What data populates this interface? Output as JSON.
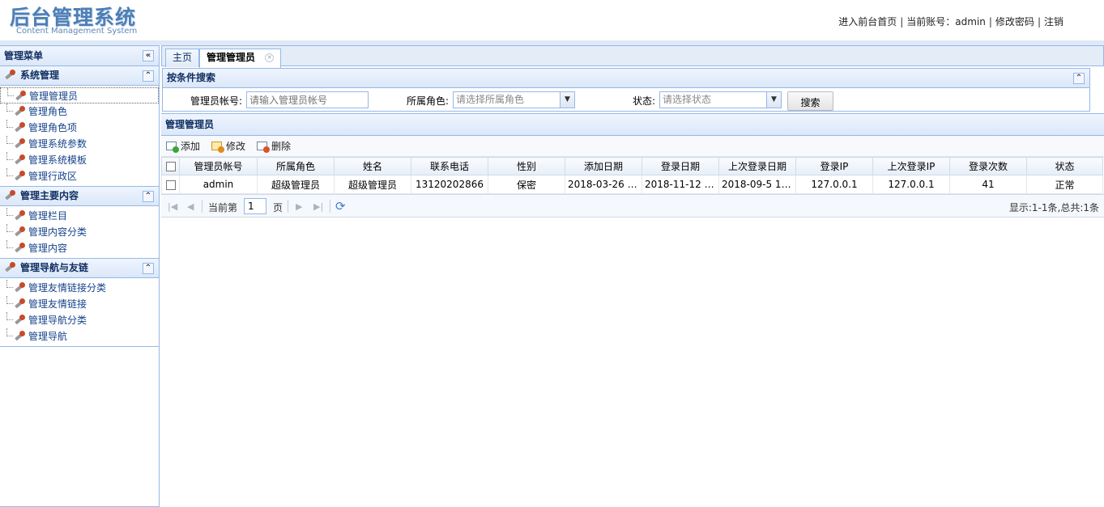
{
  "header": {
    "logo_title": "后台管理系统",
    "logo_subtitle": "Content Management System",
    "links": [
      "进入前台首页",
      "当前账号：admin",
      "修改密码",
      "注销"
    ]
  },
  "menu": {
    "title": "管理菜单",
    "groups": [
      {
        "label": "系统管理",
        "items": [
          "管理管理员",
          "管理角色",
          "管理角色项",
          "管理系统参数",
          "管理系统模板",
          "管理行政区"
        ]
      },
      {
        "label": "管理主要内容",
        "items": [
          "管理栏目",
          "管理内容分类",
          "管理内容"
        ]
      },
      {
        "label": "管理导航与友链",
        "items": [
          "管理友情链接分类",
          "管理友情链接",
          "管理导航分类",
          "管理导航"
        ]
      }
    ]
  },
  "tabs": [
    "主页",
    "管理管理员"
  ],
  "search": {
    "title": "按条件搜索",
    "account_label": "管理员帐号:",
    "account_placeholder": "请输入管理员帐号",
    "role_label": "所属角色:",
    "role_placeholder": "请选择所属角色",
    "status_label": "状态:",
    "status_placeholder": "请选择状态",
    "button": "搜索"
  },
  "grid": {
    "title": "管理管理员",
    "toolbar": [
      "添加",
      "修改",
      "删除"
    ],
    "columns": [
      "管理员帐号",
      "所属角色",
      "姓名",
      "联系电话",
      "性别",
      "添加日期",
      "登录日期",
      "上次登录日期",
      "登录IP",
      "上次登录IP",
      "登录次数",
      "状态"
    ],
    "rows": [
      [
        "admin",
        "超级管理员",
        "超级管理员",
        "13120202866",
        "保密",
        "2018-03-26 1...",
        "2018-11-12 1...",
        "2018-09-5 15...",
        "127.0.0.1",
        "127.0.0.1",
        "41",
        "正常"
      ]
    ]
  },
  "pager": {
    "current_label": "当前第",
    "page": "1",
    "page_suffix": "页",
    "info": "显示:1-1条,总共:1条"
  },
  "colors": {
    "border": "#95b8e7",
    "header_bg": "#dbe7f8",
    "link": "#15428b",
    "logo": "#4d7eb6"
  }
}
